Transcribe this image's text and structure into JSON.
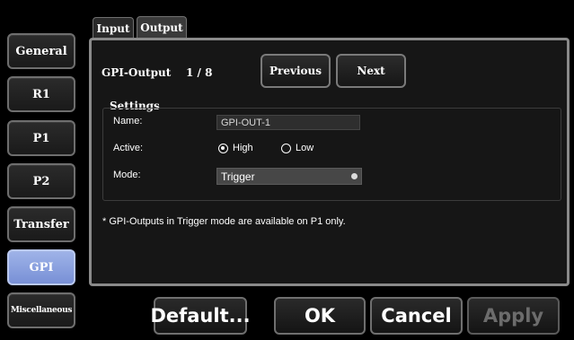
{
  "nav": {
    "items": [
      "General",
      "R1",
      "P1",
      "P2",
      "Transfer",
      "GPI",
      "Miscellaneous"
    ],
    "active": "GPI"
  },
  "tabs": [
    "Input",
    "Output"
  ],
  "active_tab": "Output",
  "output": {
    "label": "GPI-Output",
    "counter": "1 / 8",
    "previous_label": "Previous",
    "next_label": "Next"
  },
  "settings": {
    "heading": "Settings",
    "name_label": "Name:",
    "name_value": "GPI-OUT-1",
    "active_label": "Active:",
    "active_options": [
      "High",
      "Low"
    ],
    "active_selected": "High",
    "mode_label": "Mode:",
    "mode_value": "Trigger"
  },
  "note": "* GPI-Outputs in Trigger mode are available on P1 only.",
  "footer": {
    "default_label": "Default...",
    "ok_label": "OK",
    "cancel_label": "Cancel",
    "apply_label": "Apply"
  }
}
